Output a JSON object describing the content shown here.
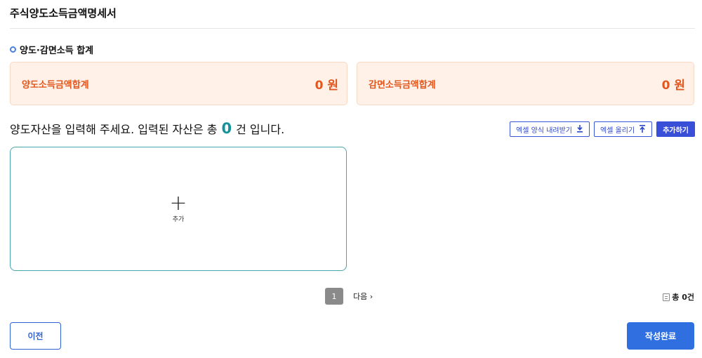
{
  "page": {
    "title": "주식양도소득금액명세서"
  },
  "section": {
    "title": "양도·감면소득 합계"
  },
  "summary": {
    "transfer_label": "양도소득금액합계",
    "transfer_value": "0 원",
    "reduction_label": "감면소득금액합계",
    "reduction_value": "0 원"
  },
  "assets": {
    "prefix": "양도자산을 입력해 주세요. 입력된 자산은 총",
    "count": "0",
    "suffix": "건 입니다."
  },
  "toolbar": {
    "excel_download_label": "엑셀 양식 내려받기",
    "excel_upload_label": "엑셀 올리기",
    "add_label": "추가하기"
  },
  "add_card": {
    "plus": "+",
    "label": "추가"
  },
  "pagination": {
    "current_page": "1",
    "next_label": "다음 ›"
  },
  "total": {
    "text": "총 0건"
  },
  "footer": {
    "prev_label": "이전",
    "done_label": "작성완료"
  },
  "colors": {
    "accent": "#2f6fe0",
    "sum_text": "#e2571e",
    "count": "#15929a"
  }
}
